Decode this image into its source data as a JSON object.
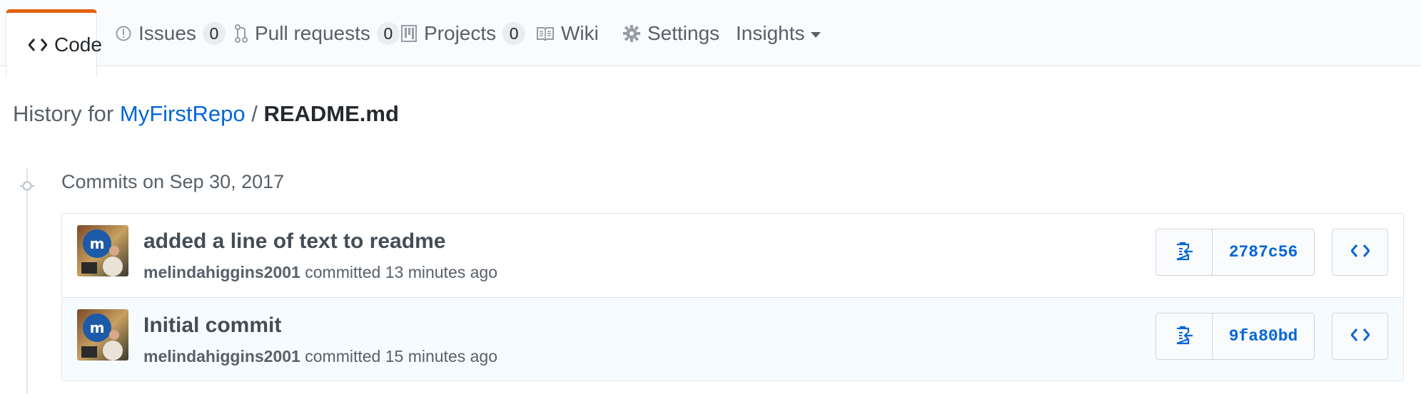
{
  "tabs": [
    {
      "label": "Code",
      "icon": "code-icon",
      "selected": true
    },
    {
      "label": "Issues",
      "icon": "issue-opened-icon",
      "count": "0"
    },
    {
      "label": "Pull requests",
      "icon": "git-pull-request-icon",
      "count": "0"
    },
    {
      "label": "Projects",
      "icon": "project-icon",
      "count": "0"
    },
    {
      "label": "Wiki",
      "icon": "book-icon"
    },
    {
      "label": "Settings",
      "icon": "gear-icon"
    },
    {
      "label": "Insights",
      "icon": "caret-down-icon"
    }
  ],
  "history": {
    "prefix": "History for",
    "repo": "MyFirstRepo",
    "separator": "/",
    "file": "README.md"
  },
  "commits_date": "Commits on Sep 30, 2017",
  "commits": [
    {
      "title": "added a line of text to readme",
      "author": "melindahiggins2001",
      "action": "committed",
      "time": "13 minutes ago",
      "sha": "2787c56"
    },
    {
      "title": "Initial commit",
      "author": "melindahiggins2001",
      "action": "committed",
      "time": "15 minutes ago",
      "sha": "9fa80bd"
    }
  ],
  "colors": {
    "accent": "#e36209",
    "link": "#0366d6",
    "text": "#24292e",
    "muted": "#586069"
  }
}
